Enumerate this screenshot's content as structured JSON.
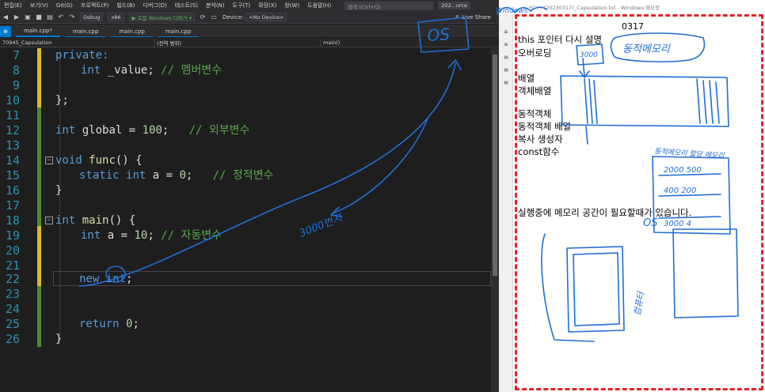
{
  "vs": {
    "menu": [
      "편집(E)",
      "보기(V)",
      "Git(G)",
      "프로젝트(P)",
      "빌드(B)",
      "디버그(D)",
      "테스트(S)",
      "분석(N)",
      "도구(T)",
      "확장(X)",
      "창(W)",
      "도움말(H)"
    ],
    "search_placeholder": "검색 (Ctrl+Q)",
    "solution_name": "202...urce",
    "toolbar": {
      "config": "Debug",
      "platform": "x86",
      "run_label": "▶ 로컬 Windows 디버거 ▾",
      "device_label": "Device:",
      "device_value": "<No Device>",
      "live_share": "Live Share"
    },
    "tabs": [
      "main.cpp*",
      "main.cpp",
      "main.cpp",
      "main.cpp"
    ],
    "nav": {
      "project": "70945_Capsulation",
      "scope": "(전역 범위)",
      "member": "main()"
    },
    "code_lines": [
      {
        "n": "7",
        "text": "private:"
      },
      {
        "n": "8",
        "text": "int _value; // 멤버변수"
      },
      {
        "n": "9",
        "text": ""
      },
      {
        "n": "10",
        "text": "};"
      },
      {
        "n": "11",
        "text": ""
      },
      {
        "n": "12",
        "text": "int global = 100;   // 외부변수"
      },
      {
        "n": "13",
        "text": ""
      },
      {
        "n": "14",
        "text": "void func() {"
      },
      {
        "n": "15",
        "text": "static int a = 0;   // 정적변수"
      },
      {
        "n": "16",
        "text": "}"
      },
      {
        "n": "17",
        "text": ""
      },
      {
        "n": "18",
        "text": "int main() {"
      },
      {
        "n": "19",
        "text": "int a = 10; // 자동변수"
      },
      {
        "n": "20",
        "text": ""
      },
      {
        "n": "21",
        "text": ""
      },
      {
        "n": "22",
        "text": "new int;"
      },
      {
        "n": "23",
        "text": ""
      },
      {
        "n": "24",
        "text": ""
      },
      {
        "n": "25",
        "text": "return 0;"
      },
      {
        "n": "26",
        "text": "}"
      }
    ]
  },
  "notepad": {
    "title": "*C++(20230317)_Capsulation.txt - Windows 메모장",
    "date_marker": "0317",
    "lines": [
      "this 포인터 다시 설명",
      "오버로딩",
      "배열",
      "객체배열",
      "동적객체",
      "동적객체 배열",
      "복사 생성자",
      "const함수",
      "실행중에 메모리 공간이 필요할때가 있습니다."
    ]
  },
  "annotations": {
    "handwriting": [
      "OS",
      "3000번지",
      "OS",
      "3000",
      "동적메모리",
      "동적메모리 할당 메모리",
      "2000 500",
      "400 200",
      "3000 4",
      "OS",
      "컴퓨터",
      "Windows"
    ]
  },
  "colors": {
    "editor_bg": "#1e1e1e",
    "keyword": "#569cd6",
    "comment": "#57a64a",
    "line_number": "#2b91af",
    "ink_blue": "#1f6fd6",
    "dash_red": "#e8202a"
  }
}
